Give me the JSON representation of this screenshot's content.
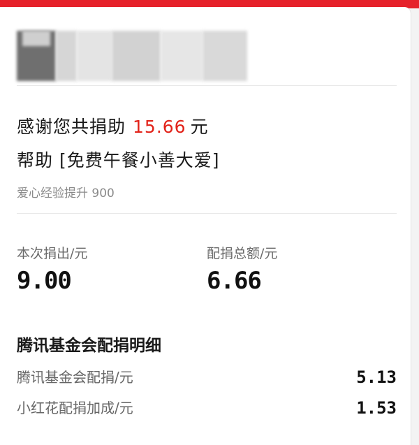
{
  "header": {
    "avatar_blurred": true
  },
  "summary": {
    "thanks_prefix": "感谢您共捐助",
    "total_amount": "15.66",
    "currency": "元",
    "help_prefix": "帮助",
    "project_name": "[免费午餐小善大爱]",
    "love_exp_label": "爱心经验提升",
    "love_exp_value": "900"
  },
  "stats": {
    "my_donation_label": "本次捐出/元",
    "my_donation_value": "9.00",
    "match_total_label": "配捐总额/元",
    "match_total_value": "6.66"
  },
  "details": {
    "title": "腾讯基金会配捐明细",
    "rows": [
      {
        "label": "腾讯基金会配捐/元",
        "value": "5.13"
      },
      {
        "label": "小红花配捐加成/元",
        "value": "1.53"
      }
    ]
  },
  "colors": {
    "accent": "#e2231a",
    "top_bar": "#e6212a"
  }
}
